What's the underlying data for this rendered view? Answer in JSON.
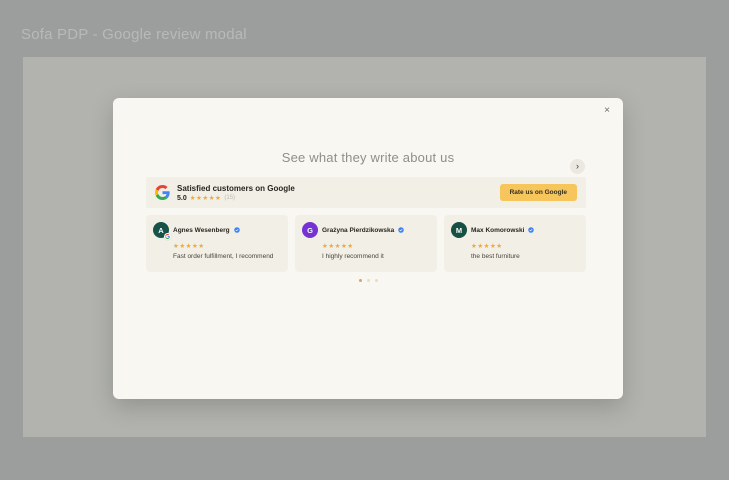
{
  "page": {
    "title": "Sofa PDP - Google review modal"
  },
  "icons": {
    "close": "×",
    "chevron_right": "›",
    "star": "★"
  },
  "modal": {
    "heading": "See what they write about us",
    "summary": {
      "title": "Satisfied customers on Google",
      "rating": "5.0",
      "stars": "★★★★★",
      "review_count": "(15)",
      "cta_label": "Rate us on Google"
    },
    "reviews": [
      {
        "initial": "A",
        "name": "Agnes Wesenberg",
        "stars": "★★★★★",
        "text": "Fast order fulfillment, I recommend"
      },
      {
        "initial": "G",
        "name": "Grażyna Pierdzikowska",
        "stars": "★★★★★",
        "text": "I highly recommend it"
      },
      {
        "initial": "M",
        "name": "Max Komorowski",
        "stars": "★★★★★",
        "text": "the best furniture"
      }
    ],
    "pagination": {
      "dot_count": 3,
      "active_index": 0
    }
  },
  "colors": {
    "accent_amber": "#F6C55C",
    "star": "#F0A83F",
    "verified_blue": "#3E82F5",
    "avatar_agnes": "#175349",
    "avatar_grazyna": "#7633D3",
    "avatar_max": "#164F44",
    "modal_bg": "#F9F7F2",
    "panel_bg": "#F2EFE6",
    "backdrop_gray": "#B2B3AF",
    "outer_gray": "#9B9E9C"
  }
}
